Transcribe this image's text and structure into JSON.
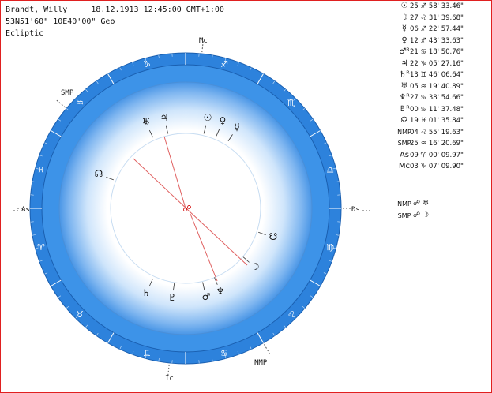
{
  "header": {
    "line1": "Brandt, Willy     18.12.1913 12:45:00 GMT+1:00",
    "line2": "53N51'60\" 10E40'00\" Geo",
    "line3": "Ecliptic"
  },
  "axes": {
    "mc": "Mc",
    "ic": "Ic",
    "as": "As",
    "ds": "Ds",
    "smp": "SMP",
    "nmp": "NMP"
  },
  "zodiac": [
    "♈",
    "♉",
    "♊",
    "♋",
    "♌",
    "♍",
    "♎",
    "♏",
    "♐",
    "♑",
    "♒",
    "♓"
  ],
  "planets_chart": [
    {
      "name": "sun",
      "glyph": "☉"
    },
    {
      "name": "moon",
      "glyph": "☽"
    },
    {
      "name": "mercury",
      "glyph": "☿"
    },
    {
      "name": "venus",
      "glyph": "♀"
    },
    {
      "name": "mars",
      "glyph": "♂"
    },
    {
      "name": "jupiter",
      "glyph": "♃"
    },
    {
      "name": "saturn",
      "glyph": "♄"
    },
    {
      "name": "uranus",
      "glyph": "♅"
    },
    {
      "name": "neptune",
      "glyph": "♆"
    },
    {
      "name": "pluto",
      "glyph": "♇"
    },
    {
      "name": "node",
      "glyph": "☊"
    },
    {
      "name": "node-south",
      "glyph": "☋"
    }
  ],
  "aspect_symbol": "☍",
  "positions": [
    {
      "sym": "☉",
      "pos": "25 ♐ 58' 33.46\""
    },
    {
      "sym": "☽",
      "pos": "27 ♌ 31' 39.68\""
    },
    {
      "sym": "☿",
      "pos": "06 ♐ 22' 57.44\""
    },
    {
      "sym": "♀",
      "pos": "12 ♐ 43' 33.63\""
    },
    {
      "sym": "♂ᴿ",
      "pos": "21 ♋ 18' 50.76\""
    },
    {
      "sym": "♃",
      "pos": "22 ♑ 05' 27.16\""
    },
    {
      "sym": "♄ᴿ",
      "pos": "13 ♊ 46' 06.64\""
    },
    {
      "sym": "♅",
      "pos": "05 ♒ 19' 40.89\""
    },
    {
      "sym": "♆ᴿ",
      "pos": "27 ♋ 38' 54.66\""
    },
    {
      "sym": "♇ᴿ",
      "pos": "00 ♋ 11' 37.48\""
    },
    {
      "sym": "☊",
      "pos": "19 ♓ 01' 35.84\""
    },
    {
      "sym": "NMP",
      "pos": "04 ♌ 55' 19.63\""
    },
    {
      "sym": "SMP",
      "pos": "25 ♒ 16' 20.69\""
    },
    {
      "sym": "As",
      "pos": "09 ♈ 00' 09.97\""
    },
    {
      "sym": "Mc",
      "pos": "03 ♑ 07' 09.90\""
    }
  ],
  "aspects": [
    {
      "sym": "NMP",
      "pos": "☍ ♅"
    },
    {
      "sym": "SMP",
      "pos": "☍ ☽"
    }
  ],
  "colors": {
    "ring_outer": "#2a7fd9",
    "ring_inner": "#3d92e8",
    "border": "#e02020",
    "line": "#e06060"
  }
}
